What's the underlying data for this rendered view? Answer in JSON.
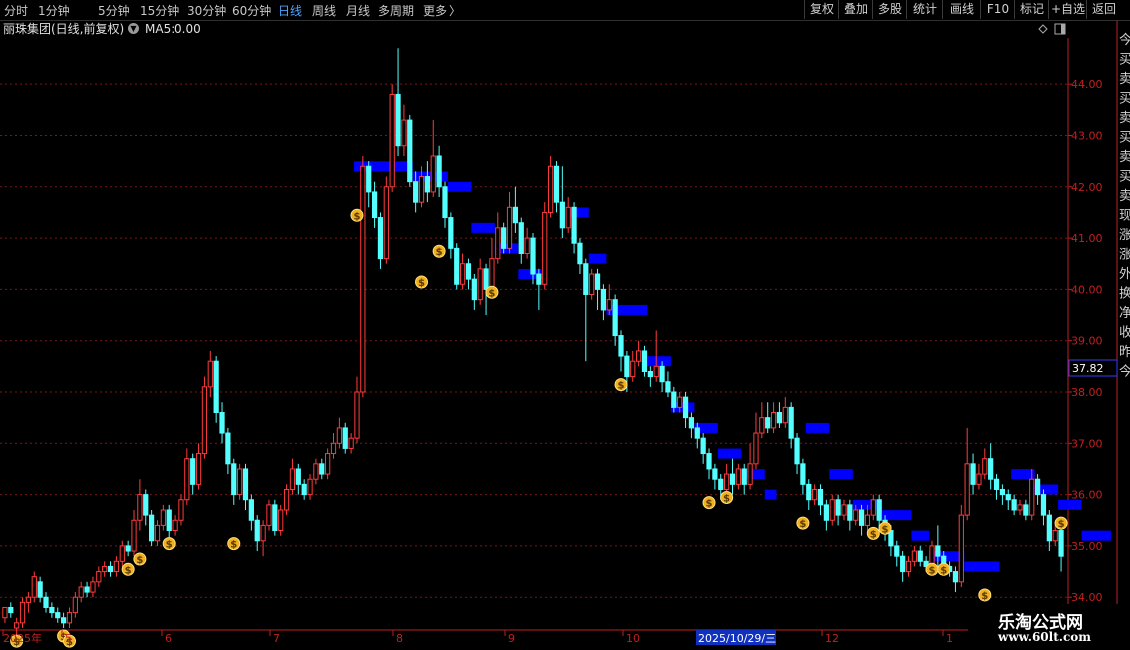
{
  "toolbar": {
    "periods": [
      "分时",
      "1分钟",
      "5分钟",
      "15分钟",
      "30分钟",
      "60分钟",
      "日线",
      "周线",
      "月线",
      "多周期",
      "更多"
    ],
    "more_chevron": "〉",
    "active_period": "日线",
    "buttons": [
      "复权",
      "叠加",
      "多股",
      "统计",
      "画线",
      "F10",
      "标记",
      "+自选",
      "返回"
    ]
  },
  "stock": {
    "title": "丽珠集团(日线,前复权)",
    "indicator_label": "MA5:",
    "indicator_value": "0.00"
  },
  "price_axis": {
    "labels": [
      "44.00",
      "43.00",
      "42.00",
      "41.00",
      "40.00",
      "39.00",
      "38.00",
      "37.00",
      "36.00",
      "35.00",
      "34.00"
    ],
    "current_price": "37.82"
  },
  "time_axis": {
    "labels": [
      "2025年",
      "5",
      "6",
      "7",
      "8",
      "9",
      "10",
      "11",
      "12",
      "1"
    ],
    "cursor_date": "2025/10/29/三"
  },
  "right_panel_chars": [
    "今",
    "买",
    "卖",
    "买",
    "卖",
    "买",
    "卖",
    "买",
    "卖",
    "现",
    "涨",
    "涨",
    "外",
    "换",
    "净",
    "收",
    "昨",
    "今"
  ],
  "watermark": {
    "site": "乐淘公式网",
    "url": "www.60lt.com"
  },
  "colors": {
    "up": "#ff3c3c",
    "down": "#54ffff",
    "axis": "#c02020",
    "grid": "#7a1818",
    "ladder": "#0000ff",
    "active_tab": "#4da3ff",
    "coin": "#f0b020"
  },
  "chart_data": {
    "type": "candlestick",
    "y_range": [
      33.4,
      44.9
    ],
    "candles": [
      [
        33.6,
        33.8,
        33.5,
        33.6
      ],
      [
        33.8,
        33.7,
        33.6,
        33.9
      ],
      [
        33.4,
        33.5,
        33.2,
        33.6
      ],
      [
        33.5,
        33.9,
        33.4,
        34.0
      ],
      [
        33.9,
        34.0,
        33.7,
        34.1
      ],
      [
        34.0,
        34.4,
        33.9,
        34.5
      ],
      [
        34.3,
        34.0,
        33.9,
        34.4
      ],
      [
        34.0,
        33.8,
        33.7,
        34.1
      ],
      [
        33.8,
        33.7,
        33.6,
        33.9
      ],
      [
        33.7,
        33.6,
        33.5,
        33.8
      ],
      [
        33.6,
        33.5,
        33.4,
        33.7
      ],
      [
        33.5,
        33.7,
        33.4,
        33.8
      ],
      [
        33.7,
        34.0,
        33.6,
        34.1
      ],
      [
        34.0,
        34.2,
        33.9,
        34.3
      ],
      [
        34.2,
        34.1,
        34.0,
        34.3
      ],
      [
        34.1,
        34.3,
        34.0,
        34.4
      ],
      [
        34.3,
        34.5,
        34.2,
        34.6
      ],
      [
        34.5,
        34.6,
        34.4,
        34.7
      ],
      [
        34.6,
        34.5,
        34.4,
        34.7
      ],
      [
        34.5,
        34.7,
        34.4,
        34.8
      ],
      [
        34.7,
        35.0,
        34.6,
        35.1
      ],
      [
        35.0,
        34.9,
        34.8,
        35.1
      ],
      [
        34.9,
        35.5,
        34.8,
        35.7
      ],
      [
        35.5,
        36.0,
        35.3,
        36.3
      ],
      [
        36.0,
        35.6,
        35.4,
        36.1
      ],
      [
        35.6,
        35.1,
        35.0,
        35.7
      ],
      [
        35.1,
        35.4,
        35.0,
        35.5
      ],
      [
        35.4,
        35.7,
        35.3,
        35.8
      ],
      [
        35.7,
        35.3,
        35.1,
        35.8
      ],
      [
        35.3,
        35.5,
        35.2,
        35.6
      ],
      [
        35.5,
        35.9,
        35.4,
        36.0
      ],
      [
        35.9,
        36.7,
        35.8,
        36.9
      ],
      [
        36.7,
        36.2,
        36.0,
        36.8
      ],
      [
        36.2,
        36.8,
        36.1,
        37.0
      ],
      [
        36.8,
        38.1,
        36.7,
        38.3
      ],
      [
        38.1,
        38.6,
        37.9,
        38.8
      ],
      [
        38.6,
        37.6,
        37.4,
        38.7
      ],
      [
        37.6,
        37.2,
        37.0,
        37.8
      ],
      [
        37.2,
        36.6,
        36.4,
        37.3
      ],
      [
        36.6,
        36.0,
        35.8,
        36.7
      ],
      [
        36.0,
        36.5,
        35.9,
        36.6
      ],
      [
        36.5,
        35.9,
        35.7,
        36.6
      ],
      [
        35.9,
        35.5,
        35.3,
        36.0
      ],
      [
        35.5,
        35.1,
        34.9,
        35.6
      ],
      [
        35.1,
        35.4,
        34.8,
        35.5
      ],
      [
        35.4,
        35.8,
        35.3,
        35.9
      ],
      [
        35.8,
        35.3,
        35.2,
        35.9
      ],
      [
        35.3,
        35.7,
        35.2,
        35.8
      ],
      [
        35.7,
        36.1,
        35.6,
        36.2
      ],
      [
        36.1,
        36.5,
        36.0,
        36.7
      ],
      [
        36.5,
        36.2,
        36.0,
        36.6
      ],
      [
        36.2,
        36.0,
        35.9,
        36.3
      ],
      [
        36.0,
        36.3,
        35.9,
        36.4
      ],
      [
        36.3,
        36.6,
        36.2,
        36.7
      ],
      [
        36.6,
        36.4,
        36.3,
        36.7
      ],
      [
        36.4,
        36.8,
        36.3,
        36.9
      ],
      [
        36.8,
        37.0,
        36.7,
        37.2
      ],
      [
        37.0,
        37.3,
        36.9,
        37.5
      ],
      [
        37.3,
        36.9,
        36.8,
        37.4
      ],
      [
        36.9,
        37.1,
        36.8,
        37.2
      ],
      [
        37.1,
        38.0,
        37.0,
        38.3
      ],
      [
        38.0,
        42.4,
        37.9,
        42.6
      ],
      [
        42.4,
        41.9,
        41.6,
        42.5
      ],
      [
        41.9,
        41.4,
        41.2,
        42.1
      ],
      [
        41.4,
        40.6,
        40.4,
        41.5
      ],
      [
        40.6,
        42.0,
        40.5,
        42.2
      ],
      [
        42.0,
        43.8,
        41.9,
        44.0
      ],
      [
        43.8,
        42.8,
        42.6,
        44.7
      ],
      [
        42.8,
        43.3,
        42.6,
        43.6
      ],
      [
        43.3,
        42.1,
        42.0,
        43.4
      ],
      [
        42.1,
        41.7,
        41.5,
        42.3
      ],
      [
        41.7,
        42.2,
        41.6,
        42.4
      ],
      [
        42.2,
        41.9,
        41.7,
        42.5
      ],
      [
        41.9,
        42.6,
        41.8,
        43.3
      ],
      [
        42.6,
        42.0,
        41.8,
        42.8
      ],
      [
        42.0,
        41.4,
        41.2,
        42.1
      ],
      [
        41.4,
        40.8,
        40.6,
        41.5
      ],
      [
        40.8,
        40.1,
        40.0,
        40.9
      ],
      [
        40.1,
        40.5,
        40.0,
        40.7
      ],
      [
        40.5,
        40.2,
        40.0,
        40.6
      ],
      [
        40.2,
        39.8,
        39.6,
        40.3
      ],
      [
        39.8,
        40.4,
        39.7,
        40.6
      ],
      [
        40.4,
        40.0,
        39.5,
        40.5
      ],
      [
        40.0,
        40.6,
        39.9,
        41.0
      ],
      [
        40.6,
        41.2,
        40.5,
        41.5
      ],
      [
        41.2,
        40.8,
        40.7,
        41.3
      ],
      [
        40.8,
        41.6,
        40.7,
        41.9
      ],
      [
        41.6,
        41.3,
        41.1,
        42.0
      ],
      [
        41.3,
        40.7,
        40.5,
        41.4
      ],
      [
        40.7,
        41.0,
        40.6,
        41.2
      ],
      [
        41.0,
        40.3,
        40.1,
        41.1
      ],
      [
        40.3,
        40.1,
        39.6,
        40.4
      ],
      [
        40.1,
        41.5,
        40.0,
        41.7
      ],
      [
        41.5,
        42.4,
        41.4,
        42.6
      ],
      [
        42.4,
        41.7,
        41.5,
        42.5
      ],
      [
        41.7,
        41.2,
        41.0,
        42.4
      ],
      [
        41.2,
        41.6,
        41.1,
        41.8
      ],
      [
        41.6,
        40.9,
        40.7,
        41.7
      ],
      [
        40.9,
        40.5,
        40.3,
        41.0
      ],
      [
        40.5,
        39.9,
        38.6,
        40.6
      ],
      [
        39.9,
        40.3,
        39.8,
        40.4
      ],
      [
        40.3,
        40.0,
        39.6,
        40.4
      ],
      [
        40.0,
        39.6,
        39.4,
        40.1
      ],
      [
        39.6,
        39.8,
        39.5,
        40.1
      ],
      [
        39.8,
        39.1,
        38.9,
        39.9
      ],
      [
        39.1,
        38.7,
        38.4,
        39.2
      ],
      [
        38.7,
        38.3,
        38.0,
        38.8
      ],
      [
        38.3,
        38.6,
        38.2,
        38.8
      ],
      [
        38.6,
        38.8,
        38.5,
        39.0
      ],
      [
        38.8,
        38.4,
        38.3,
        38.9
      ],
      [
        38.4,
        38.3,
        38.1,
        38.5
      ],
      [
        38.3,
        38.5,
        38.2,
        39.2
      ],
      [
        38.5,
        38.2,
        38.0,
        38.6
      ],
      [
        38.2,
        38.0,
        37.9,
        38.4
      ],
      [
        38.0,
        37.7,
        37.6,
        38.1
      ],
      [
        37.7,
        37.9,
        37.6,
        38.0
      ],
      [
        37.9,
        37.5,
        37.3,
        38.0
      ],
      [
        37.5,
        37.3,
        37.1,
        37.6
      ],
      [
        37.3,
        37.1,
        36.9,
        37.4
      ],
      [
        37.1,
        36.8,
        36.6,
        37.2
      ],
      [
        36.8,
        36.5,
        36.3,
        36.9
      ],
      [
        36.5,
        36.3,
        36.1,
        36.6
      ],
      [
        36.3,
        36.1,
        35.9,
        36.4
      ],
      [
        36.1,
        36.4,
        36.0,
        36.6
      ],
      [
        36.4,
        36.2,
        36.0,
        36.7
      ],
      [
        36.2,
        36.5,
        36.1,
        36.6
      ],
      [
        36.5,
        36.2,
        36.0,
        36.6
      ],
      [
        36.2,
        36.6,
        36.1,
        37.0
      ],
      [
        36.6,
        37.2,
        36.5,
        37.6
      ],
      [
        37.2,
        37.5,
        37.1,
        37.8
      ],
      [
        37.5,
        37.3,
        37.2,
        37.8
      ],
      [
        37.3,
        37.6,
        37.2,
        37.8
      ],
      [
        37.6,
        37.4,
        37.3,
        37.8
      ],
      [
        37.4,
        37.7,
        37.3,
        37.9
      ],
      [
        37.7,
        37.1,
        36.9,
        37.8
      ],
      [
        37.1,
        36.6,
        36.4,
        37.2
      ],
      [
        36.6,
        36.2,
        36.0,
        36.7
      ],
      [
        36.2,
        35.9,
        35.7,
        36.3
      ],
      [
        35.9,
        36.1,
        35.8,
        36.2
      ],
      [
        36.1,
        35.8,
        35.6,
        36.2
      ],
      [
        35.8,
        35.5,
        35.3,
        35.9
      ],
      [
        35.5,
        35.9,
        35.4,
        36.0
      ],
      [
        35.9,
        35.6,
        35.4,
        36.0
      ],
      [
        35.6,
        35.8,
        35.5,
        35.9
      ],
      [
        35.8,
        35.5,
        35.3,
        35.9
      ],
      [
        35.5,
        35.7,
        35.4,
        35.8
      ],
      [
        35.7,
        35.4,
        35.2,
        35.8
      ],
      [
        35.4,
        35.6,
        35.3,
        35.8
      ],
      [
        35.6,
        35.9,
        35.5,
        36.0
      ],
      [
        35.9,
        35.5,
        35.3,
        36.0
      ],
      [
        35.5,
        35.3,
        35.1,
        35.6
      ],
      [
        35.3,
        35.0,
        34.8,
        35.4
      ],
      [
        35.0,
        34.8,
        34.6,
        35.1
      ],
      [
        34.8,
        34.5,
        34.3,
        34.9
      ],
      [
        34.5,
        34.7,
        34.4,
        34.8
      ],
      [
        34.7,
        34.9,
        34.6,
        35.0
      ],
      [
        34.9,
        34.7,
        34.6,
        35.0
      ],
      [
        34.7,
        34.6,
        34.5,
        34.8
      ],
      [
        34.6,
        35.0,
        34.5,
        35.1
      ],
      [
        35.0,
        34.8,
        34.6,
        35.4
      ],
      [
        34.8,
        34.6,
        34.5,
        34.9
      ],
      [
        34.6,
        34.5,
        34.4,
        34.7
      ],
      [
        34.5,
        34.3,
        34.1,
        34.6
      ],
      [
        34.3,
        35.6,
        34.2,
        35.8
      ],
      [
        35.6,
        36.6,
        35.5,
        37.3
      ],
      [
        36.6,
        36.2,
        36.0,
        36.8
      ],
      [
        36.2,
        36.4,
        36.1,
        36.6
      ],
      [
        36.4,
        36.7,
        36.3,
        36.9
      ],
      [
        36.7,
        36.3,
        36.1,
        37.0
      ],
      [
        36.3,
        36.1,
        35.9,
        36.4
      ],
      [
        36.1,
        36.0,
        35.8,
        36.2
      ],
      [
        36.0,
        35.9,
        35.7,
        36.1
      ],
      [
        35.9,
        35.7,
        35.6,
        36.0
      ],
      [
        35.7,
        35.8,
        35.6,
        35.9
      ],
      [
        35.8,
        35.6,
        35.5,
        35.9
      ],
      [
        35.6,
        36.3,
        35.5,
        36.5
      ],
      [
        36.3,
        36.0,
        35.8,
        36.4
      ],
      [
        36.0,
        35.6,
        35.4,
        36.1
      ],
      [
        35.6,
        35.1,
        34.9,
        35.7
      ],
      [
        35.1,
        35.3,
        35.0,
        35.4
      ],
      [
        35.3,
        34.8,
        34.5,
        35.4
      ]
    ],
    "ladder": [
      [
        42.4,
        60,
        70
      ],
      [
        42.2,
        70,
        76
      ],
      [
        42.0,
        76,
        80
      ],
      [
        41.2,
        80,
        84
      ],
      [
        40.8,
        84,
        88
      ],
      [
        40.3,
        88,
        92
      ],
      [
        41.5,
        96,
        100
      ],
      [
        40.6,
        100,
        103
      ],
      [
        39.6,
        103,
        110
      ],
      [
        38.6,
        110,
        114
      ],
      [
        37.7,
        114,
        118
      ],
      [
        37.3,
        118,
        122
      ],
      [
        36.8,
        122,
        126
      ],
      [
        36.4,
        126,
        130
      ],
      [
        36.0,
        130,
        132
      ],
      [
        37.3,
        137,
        141
      ],
      [
        36.4,
        141,
        145
      ],
      [
        35.8,
        145,
        150
      ],
      [
        35.6,
        150,
        155
      ],
      [
        35.2,
        155,
        158
      ],
      [
        34.8,
        158,
        164
      ],
      [
        34.6,
        164,
        170
      ],
      [
        36.4,
        172,
        176
      ],
      [
        36.1,
        176,
        180
      ],
      [
        35.8,
        180,
        184
      ],
      [
        35.2,
        184,
        189
      ]
    ],
    "coins": [
      [
        2,
        33.3
      ],
      [
        10,
        33.4
      ],
      [
        11,
        33.3
      ],
      [
        21,
        34.7
      ],
      [
        23,
        34.9
      ],
      [
        28,
        35.2
      ],
      [
        39,
        35.2
      ],
      [
        60,
        41.6
      ],
      [
        71,
        40.3
      ],
      [
        74,
        40.9
      ],
      [
        83,
        40.1
      ],
      [
        105,
        38.3
      ],
      [
        120,
        36.0
      ],
      [
        123,
        36.1
      ],
      [
        136,
        35.6
      ],
      [
        148,
        35.4
      ],
      [
        150,
        35.5
      ],
      [
        158,
        34.7
      ],
      [
        160,
        34.7
      ],
      [
        167,
        34.2
      ],
      [
        180,
        35.6
      ]
    ]
  }
}
